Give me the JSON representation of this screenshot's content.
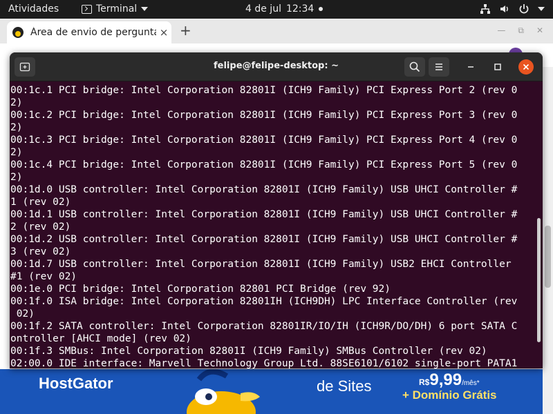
{
  "topbar": {
    "activities": "Atividades",
    "app_name": "Terminal",
    "date": "4 de jul",
    "time": "12:34"
  },
  "browser": {
    "tab_title": "Área de envio de pergunta",
    "close_glyph": "×",
    "newtab_glyph": "+",
    "win_minimize": "—",
    "win_restore": "⧉",
    "win_close": "✕"
  },
  "ad": {
    "brand": "HostGator",
    "sites": "de Sites",
    "currency": "R$",
    "price": "9,99",
    "per": "/mês*",
    "domain": "+ Domínio Grátis"
  },
  "terminal": {
    "title": "felipe@felipe-desktop: ~",
    "lines": [
      "00:1c.1 PCI bridge: Intel Corporation 82801I (ICH9 Family) PCI Express Port 2 (rev 0",
      "2)",
      "00:1c.2 PCI bridge: Intel Corporation 82801I (ICH9 Family) PCI Express Port 3 (rev 0",
      "2)",
      "00:1c.3 PCI bridge: Intel Corporation 82801I (ICH9 Family) PCI Express Port 4 (rev 0",
      "2)",
      "00:1c.4 PCI bridge: Intel Corporation 82801I (ICH9 Family) PCI Express Port 5 (rev 0",
      "2)",
      "00:1d.0 USB controller: Intel Corporation 82801I (ICH9 Family) USB UHCI Controller #",
      "1 (rev 02)",
      "00:1d.1 USB controller: Intel Corporation 82801I (ICH9 Family) USB UHCI Controller #",
      "2 (rev 02)",
      "00:1d.2 USB controller: Intel Corporation 82801I (ICH9 Family) USB UHCI Controller #",
      "3 (rev 02)",
      "00:1d.7 USB controller: Intel Corporation 82801I (ICH9 Family) USB2 EHCI Controller",
      "#1 (rev 02)",
      "00:1e.0 PCI bridge: Intel Corporation 82801 PCI Bridge (rev 92)",
      "00:1f.0 ISA bridge: Intel Corporation 82801IH (ICH9DH) LPC Interface Controller (rev",
      " 02)",
      "00:1f.2 SATA controller: Intel Corporation 82801IR/IO/IH (ICH9R/DO/DH) 6 port SATA C",
      "ontroller [AHCI mode] (rev 02)",
      "00:1f.3 SMBus: Intel Corporation 82801I (ICH9 Family) SMBus Controller (rev 02)",
      "02:00.0 IDE interface: Marvell Technology Group Ltd. 88SE6101/6102 single-port PATA1"
    ]
  },
  "colors": {
    "terminal_bg": "#300a24",
    "header_bg": "#2b2b2b",
    "close_accent": "#e95420",
    "ad_blue": "#1a55b8"
  },
  "icons": {
    "app_menu": "terminal-icon",
    "new_tab": "new-tab-icon",
    "search": "search-icon",
    "menu": "hamburger-menu-icon",
    "network": "network-icon",
    "volume": "volume-icon",
    "power": "power-icon"
  }
}
